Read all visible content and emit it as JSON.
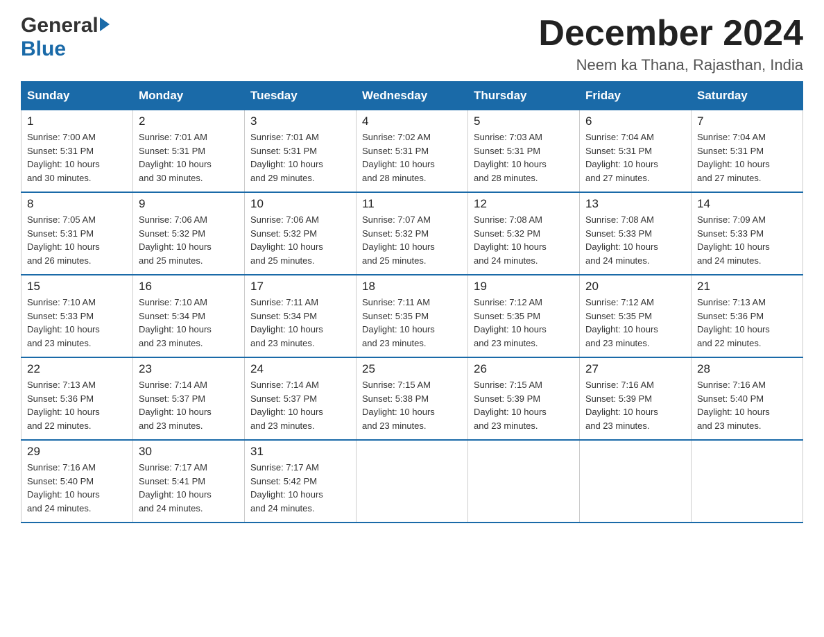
{
  "header": {
    "logo_general": "General",
    "logo_blue": "Blue",
    "month_title": "December 2024",
    "location": "Neem ka Thana, Rajasthan, India"
  },
  "days_of_week": [
    "Sunday",
    "Monday",
    "Tuesday",
    "Wednesday",
    "Thursday",
    "Friday",
    "Saturday"
  ],
  "weeks": [
    [
      {
        "day": "1",
        "sunrise": "7:00 AM",
        "sunset": "5:31 PM",
        "daylight": "10 hours and 30 minutes."
      },
      {
        "day": "2",
        "sunrise": "7:01 AM",
        "sunset": "5:31 PM",
        "daylight": "10 hours and 30 minutes."
      },
      {
        "day": "3",
        "sunrise": "7:01 AM",
        "sunset": "5:31 PM",
        "daylight": "10 hours and 29 minutes."
      },
      {
        "day": "4",
        "sunrise": "7:02 AM",
        "sunset": "5:31 PM",
        "daylight": "10 hours and 28 minutes."
      },
      {
        "day": "5",
        "sunrise": "7:03 AM",
        "sunset": "5:31 PM",
        "daylight": "10 hours and 28 minutes."
      },
      {
        "day": "6",
        "sunrise": "7:04 AM",
        "sunset": "5:31 PM",
        "daylight": "10 hours and 27 minutes."
      },
      {
        "day": "7",
        "sunrise": "7:04 AM",
        "sunset": "5:31 PM",
        "daylight": "10 hours and 27 minutes."
      }
    ],
    [
      {
        "day": "8",
        "sunrise": "7:05 AM",
        "sunset": "5:31 PM",
        "daylight": "10 hours and 26 minutes."
      },
      {
        "day": "9",
        "sunrise": "7:06 AM",
        "sunset": "5:32 PM",
        "daylight": "10 hours and 25 minutes."
      },
      {
        "day": "10",
        "sunrise": "7:06 AM",
        "sunset": "5:32 PM",
        "daylight": "10 hours and 25 minutes."
      },
      {
        "day": "11",
        "sunrise": "7:07 AM",
        "sunset": "5:32 PM",
        "daylight": "10 hours and 25 minutes."
      },
      {
        "day": "12",
        "sunrise": "7:08 AM",
        "sunset": "5:32 PM",
        "daylight": "10 hours and 24 minutes."
      },
      {
        "day": "13",
        "sunrise": "7:08 AM",
        "sunset": "5:33 PM",
        "daylight": "10 hours and 24 minutes."
      },
      {
        "day": "14",
        "sunrise": "7:09 AM",
        "sunset": "5:33 PM",
        "daylight": "10 hours and 24 minutes."
      }
    ],
    [
      {
        "day": "15",
        "sunrise": "7:10 AM",
        "sunset": "5:33 PM",
        "daylight": "10 hours and 23 minutes."
      },
      {
        "day": "16",
        "sunrise": "7:10 AM",
        "sunset": "5:34 PM",
        "daylight": "10 hours and 23 minutes."
      },
      {
        "day": "17",
        "sunrise": "7:11 AM",
        "sunset": "5:34 PM",
        "daylight": "10 hours and 23 minutes."
      },
      {
        "day": "18",
        "sunrise": "7:11 AM",
        "sunset": "5:35 PM",
        "daylight": "10 hours and 23 minutes."
      },
      {
        "day": "19",
        "sunrise": "7:12 AM",
        "sunset": "5:35 PM",
        "daylight": "10 hours and 23 minutes."
      },
      {
        "day": "20",
        "sunrise": "7:12 AM",
        "sunset": "5:35 PM",
        "daylight": "10 hours and 23 minutes."
      },
      {
        "day": "21",
        "sunrise": "7:13 AM",
        "sunset": "5:36 PM",
        "daylight": "10 hours and 22 minutes."
      }
    ],
    [
      {
        "day": "22",
        "sunrise": "7:13 AM",
        "sunset": "5:36 PM",
        "daylight": "10 hours and 22 minutes."
      },
      {
        "day": "23",
        "sunrise": "7:14 AM",
        "sunset": "5:37 PM",
        "daylight": "10 hours and 23 minutes."
      },
      {
        "day": "24",
        "sunrise": "7:14 AM",
        "sunset": "5:37 PM",
        "daylight": "10 hours and 23 minutes."
      },
      {
        "day": "25",
        "sunrise": "7:15 AM",
        "sunset": "5:38 PM",
        "daylight": "10 hours and 23 minutes."
      },
      {
        "day": "26",
        "sunrise": "7:15 AM",
        "sunset": "5:39 PM",
        "daylight": "10 hours and 23 minutes."
      },
      {
        "day": "27",
        "sunrise": "7:16 AM",
        "sunset": "5:39 PM",
        "daylight": "10 hours and 23 minutes."
      },
      {
        "day": "28",
        "sunrise": "7:16 AM",
        "sunset": "5:40 PM",
        "daylight": "10 hours and 23 minutes."
      }
    ],
    [
      {
        "day": "29",
        "sunrise": "7:16 AM",
        "sunset": "5:40 PM",
        "daylight": "10 hours and 24 minutes."
      },
      {
        "day": "30",
        "sunrise": "7:17 AM",
        "sunset": "5:41 PM",
        "daylight": "10 hours and 24 minutes."
      },
      {
        "day": "31",
        "sunrise": "7:17 AM",
        "sunset": "5:42 PM",
        "daylight": "10 hours and 24 minutes."
      },
      null,
      null,
      null,
      null
    ]
  ],
  "labels": {
    "sunrise": "Sunrise:",
    "sunset": "Sunset:",
    "daylight": "Daylight:"
  },
  "colors": {
    "header_bg": "#1a6aa8",
    "header_text": "#ffffff",
    "border": "#cccccc",
    "row_border": "#1a6aa8"
  }
}
